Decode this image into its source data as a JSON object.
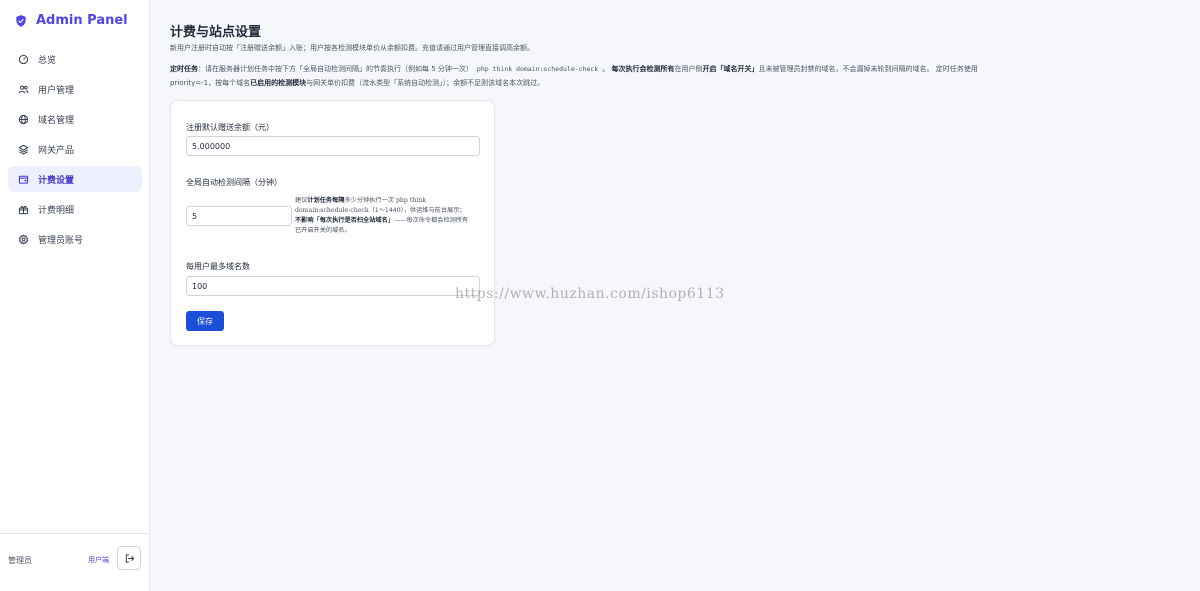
{
  "app": {
    "title": "Admin Panel"
  },
  "sidebar": {
    "items": [
      {
        "label": "总览",
        "icon": "gauge-icon",
        "active": false
      },
      {
        "label": "用户管理",
        "icon": "users-icon",
        "active": false
      },
      {
        "label": "域名管理",
        "icon": "globe-icon",
        "active": false
      },
      {
        "label": "网关产品",
        "icon": "layers-icon",
        "active": false
      },
      {
        "label": "计费设置",
        "icon": "wallet-icon",
        "active": true
      },
      {
        "label": "计费明细",
        "icon": "receipt-icon",
        "active": false
      },
      {
        "label": "管理员账号",
        "icon": "gear-icon",
        "active": false
      }
    ],
    "footer": {
      "user": "管理员",
      "link": "用户端",
      "logout_icon": "logout-icon"
    }
  },
  "page": {
    "title": "计费与站点设置",
    "description": "新用户注册时自动按「注册赠送余额」入账；用户按各检测模块单价从余额扣费。充值请通过用户管理直接调高余额。",
    "cron": {
      "label": "定时任务",
      "part1": "：请在服务器计划任务中按下方「全局自动检测间隔」的节奏执行（例如每 5 分钟一次）",
      "command": "php think domain:schedule-check",
      "part2": "。",
      "bold1": "每次执行会检测所有",
      "part3": "在用户侧",
      "bold2": "开启「域名开关」",
      "part4": "且未被管理员封禁的域名，不会漏掉未轮到间隔的域名。 定时任务使用 priority=-1，按每个域名",
      "bold3": "已启用的检测模块",
      "part5": "与网关单价扣费（流水类型「系统自动检测」）；余额不足则该域名本次跳过。"
    }
  },
  "form": {
    "bonus": {
      "label": "注册默认赠送余额（元）",
      "value": "5.000000"
    },
    "interval": {
      "label": "全局自动检测间隔（分钟）",
      "value": "5",
      "hint_prefix": "建议",
      "hint_bold1": "计划任务每隔",
      "hint_mid1": "多少分钟执行一次 ",
      "hint_cmd": "php think domain:schedule-check",
      "hint_mid2": "（1～1440），供运维与前台展示；",
      "hint_bold2": "不影响「每次执行是否扫全站域名」",
      "hint_end": "——每次命令都会检测所有已开启开关的域名。"
    },
    "max_domains": {
      "label": "每用户最多域名数",
      "value": "100"
    },
    "save_label": "保存"
  },
  "watermark": "https://www.huzhan.com/ishop6113",
  "colors": {
    "accent": "#4f46e5",
    "primary_button": "#1d4ed8",
    "active_bg": "#eef0ff"
  }
}
